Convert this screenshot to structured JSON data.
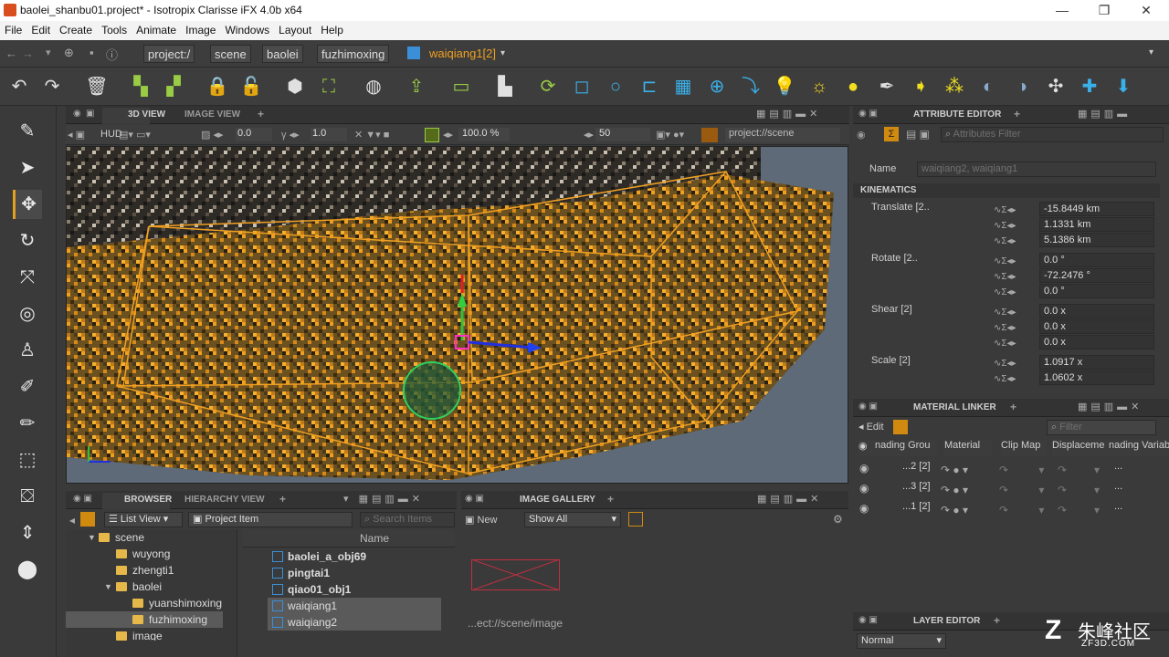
{
  "window": {
    "title": "baolei_shanbu01.project* - Isotropix Clarisse iFX 4.0b x64",
    "minimize": "—",
    "maximize": "❐",
    "close": "✕"
  },
  "menu": [
    "File",
    "Edit",
    "Create",
    "Tools",
    "Animate",
    "Image",
    "Windows",
    "Layout",
    "Help"
  ],
  "path": {
    "crumbs": [
      "project:/",
      "scene",
      "baolei",
      "fuzhimoxing"
    ],
    "current": "waiqiang1[2]"
  },
  "toolbar_icons": [
    "undo-icon",
    "redo-icon",
    "delete-icon",
    "group-icon",
    "ungroup-icon",
    "lock-icon",
    "unlock-icon",
    "cube-icon",
    "transform-icon",
    "globe-icon",
    "import-icon",
    "message-icon",
    "layer-icon",
    "refresh-icon",
    "box-icon",
    "sphere-icon",
    "cylinder-icon",
    "grid-icon",
    "globe-wire-icon",
    "arrow-icon",
    "light-bulb-icon",
    "sun-icon",
    "sun-filled-icon",
    "spot-icon",
    "directional-icon",
    "area-light-icon",
    "environment-icon",
    "sky-icon",
    "move-icon",
    "add-icon",
    "drop-icon"
  ],
  "viewport": {
    "tabs": {
      "active": "3D VIEW",
      "other": "IMAGE VIEW",
      "add": "+"
    },
    "bar": {
      "hud": "HUD",
      "v1": "0.0",
      "v2": "1.0",
      "zoom": "100.0 %",
      "frame": "50",
      "scene_path": "project://scene"
    }
  },
  "attribute_editor": {
    "title": "ATTRIBUTE EDITOR",
    "filter_placeholder": "Attributes Filter",
    "name_label": "Name",
    "name_value": "waiqiang2, waiqiang1",
    "section": "KINEMATICS",
    "groups": [
      {
        "label": "Translate [2..",
        "values": [
          "-15.8449 km",
          "1.1331 km",
          "5.1386 km"
        ]
      },
      {
        "label": "Rotate [2..",
        "values": [
          "0.0 °",
          "-72.2476 °",
          "0.0 °"
        ]
      },
      {
        "label": "Shear [2]",
        "values": [
          "0.0 x",
          "0.0 x",
          "0.0 x"
        ]
      },
      {
        "label": "Scale [2]",
        "values": [
          "1.0917 x",
          "1.0602 x"
        ]
      }
    ]
  },
  "material_linker": {
    "title": "MATERIAL LINKER",
    "edit": "Edit",
    "filter_placeholder": "Filter",
    "columns": [
      "nading Grou",
      "Material",
      "Clip Map",
      "Displaceme",
      "nading Variab"
    ],
    "rows": [
      {
        "name": "...2 [2]"
      },
      {
        "name": "...3 [2]"
      },
      {
        "name": "...1 [2]"
      }
    ],
    "more": "..."
  },
  "browser": {
    "tabs": {
      "active": "BROWSER",
      "other": "HIERARCHY VIEW",
      "add": "+"
    },
    "view_mode": "List View",
    "project_item": "Project Item",
    "search_placeholder": "Search Items",
    "column_name": "Name",
    "tree": [
      {
        "label": "scene",
        "depth": 0
      },
      {
        "label": "wuyong",
        "depth": 1
      },
      {
        "label": "zhengti1",
        "depth": 1
      },
      {
        "label": "baolei",
        "depth": 1
      },
      {
        "label": "yuanshimoxing",
        "depth": 2
      },
      {
        "label": "fuzhimoxing",
        "depth": 2
      },
      {
        "label": "image",
        "depth": 1
      }
    ],
    "items": [
      {
        "label": "baolei_a_obj69",
        "selected": false
      },
      {
        "label": "pingtai1",
        "selected": false
      },
      {
        "label": "qiao01_obj1",
        "selected": false
      },
      {
        "label": "waiqiang1",
        "selected": true
      },
      {
        "label": "waiqiang2",
        "selected": true
      }
    ]
  },
  "image_gallery": {
    "title": "IMAGE GALLERY",
    "add": "+",
    "new": "New",
    "show": "Show All",
    "path": "...ect://scene/image"
  },
  "layer_editor": {
    "title": "LAYER EDITOR",
    "add": "+",
    "blend": "Normal"
  },
  "watermark": {
    "text": "朱峰社区",
    "url": "ZF3D.COM"
  },
  "colors": {
    "accent": "#e0a020",
    "selection": "#f0a020",
    "bg": "#3a3a3a"
  }
}
